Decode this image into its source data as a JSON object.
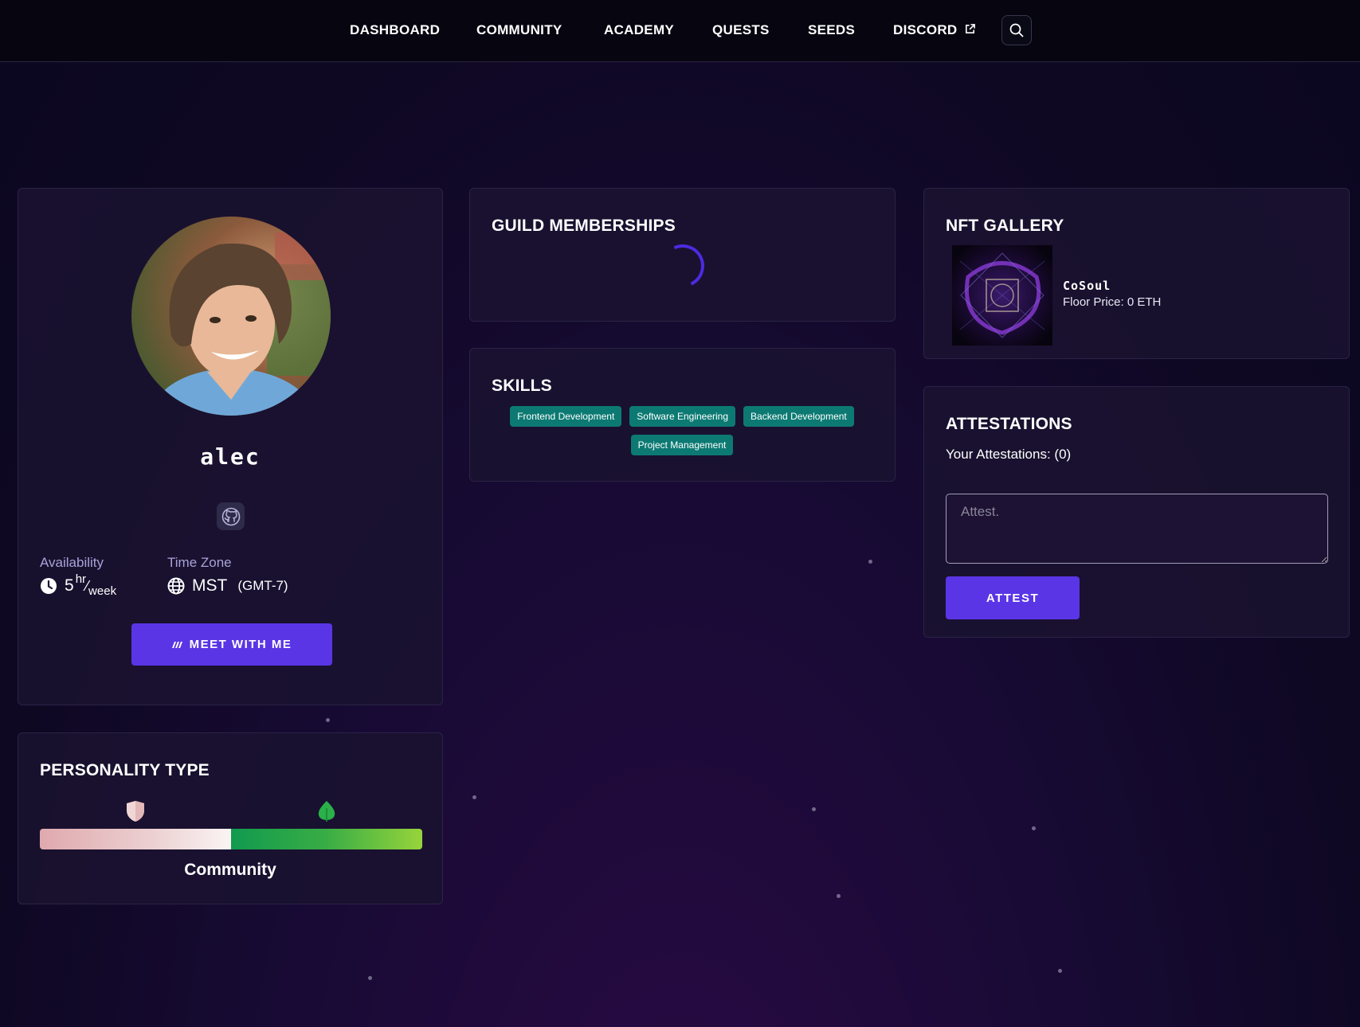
{
  "nav": {
    "items": [
      {
        "label": "DASHBOARD"
      },
      {
        "label": "COMMUNITY"
      },
      {
        "label": "ACADEMY"
      },
      {
        "label": "QUESTS"
      },
      {
        "label": "SEEDS"
      },
      {
        "label": "DISCORD"
      }
    ],
    "search_icon": "search-icon"
  },
  "profile": {
    "username": "alec",
    "github_icon": "github-icon",
    "availability": {
      "label": "Availability",
      "hours": "5",
      "unit_top": "hr",
      "unit_slash": "⁄",
      "unit_bottom": "week"
    },
    "timezone": {
      "label": "Time Zone",
      "abbr": "MST",
      "offset": "(GMT-7)"
    },
    "meet_button": "MEET WITH ME"
  },
  "personality": {
    "title": "PERSONALITY TYPE",
    "type_label": "Community",
    "colors": {
      "shield": "#f0d6d6",
      "leaf": "#2bb04a"
    }
  },
  "guild": {
    "title": "GUILD MEMBERSHIPS"
  },
  "skills": {
    "title": "SKILLS",
    "tags": [
      "Frontend Development",
      "Software Engineering",
      "Backend Development",
      "Project Management"
    ]
  },
  "nft": {
    "title": "NFT GALLERY",
    "items": [
      {
        "name": "CoSoul",
        "floor": "Floor Price: 0 ETH"
      }
    ]
  },
  "attestations": {
    "title": "ATTESTATIONS",
    "count_text": "Your Attestations: (0)",
    "placeholder": "Attest.",
    "button": "ATTEST"
  },
  "colors": {
    "accent": "#5a35e6",
    "skill_tag": "#0c7a73",
    "background": "#0e0822"
  }
}
